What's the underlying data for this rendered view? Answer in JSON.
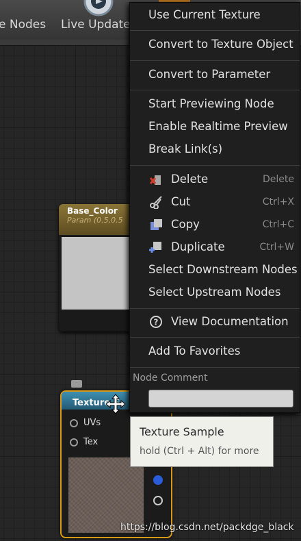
{
  "toolbar": {
    "nodes_button_label": "e Nodes",
    "live_update_button_label": "Live Update"
  },
  "nodes": {
    "base_color": {
      "title": "Base_Color",
      "subtitle": "Param (0.5,0.5"
    },
    "texture_sample": {
      "title": "Texture S",
      "pins": [
        {
          "label": "UVs"
        },
        {
          "label": "Tex"
        }
      ]
    }
  },
  "context_menu": {
    "items": [
      {
        "label": "Use Current Texture"
      },
      {
        "label": "Convert to Texture Object"
      },
      {
        "label": "Convert to Parameter"
      },
      {
        "label": "Start Previewing Node"
      },
      {
        "label": "Enable Realtime Preview"
      },
      {
        "label": "Break Link(s)"
      },
      {
        "label": "Delete",
        "shortcut": "Delete",
        "icon": "delete-icon"
      },
      {
        "label": "Cut",
        "shortcut": "Ctrl+X",
        "icon": "scissors-icon"
      },
      {
        "label": "Copy",
        "shortcut": "Ctrl+C",
        "icon": "copy-icon"
      },
      {
        "label": "Duplicate",
        "shortcut": "Ctrl+W",
        "icon": "duplicate-icon"
      },
      {
        "label": "Select Downstream Nodes"
      },
      {
        "label": "Select Upstream Nodes"
      },
      {
        "label": "View Documentation",
        "icon": "help-icon"
      },
      {
        "label": "Add To Favorites"
      }
    ],
    "node_comment_label": "Node Comment",
    "node_comment_value": ""
  },
  "tooltip": {
    "title": "Texture Sample",
    "hint": "hold (Ctrl + Alt) for more"
  },
  "watermark": "https://blog.csdn.net/packdge_black",
  "colors": {
    "selection_outline": "#d99a1a",
    "texture_node_header": "#3f8fb0",
    "param_node_header": "#8a7436"
  }
}
